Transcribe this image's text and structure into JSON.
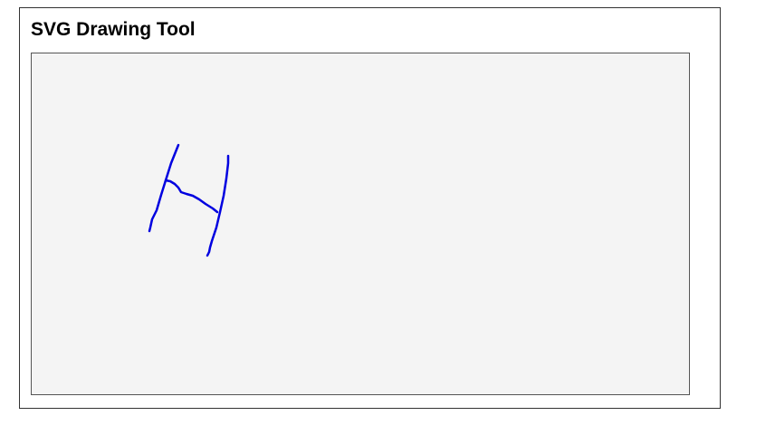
{
  "app": {
    "title": "SVG Drawing Tool"
  },
  "canvas": {
    "background": "#f4f4f4",
    "border_color": "#555555"
  },
  "drawing": {
    "stroke_color": "#0000e0",
    "strokes": [
      {
        "name": "left-vertical-stroke"
      },
      {
        "name": "crossbar-stroke"
      },
      {
        "name": "right-vertical-stroke"
      }
    ]
  }
}
